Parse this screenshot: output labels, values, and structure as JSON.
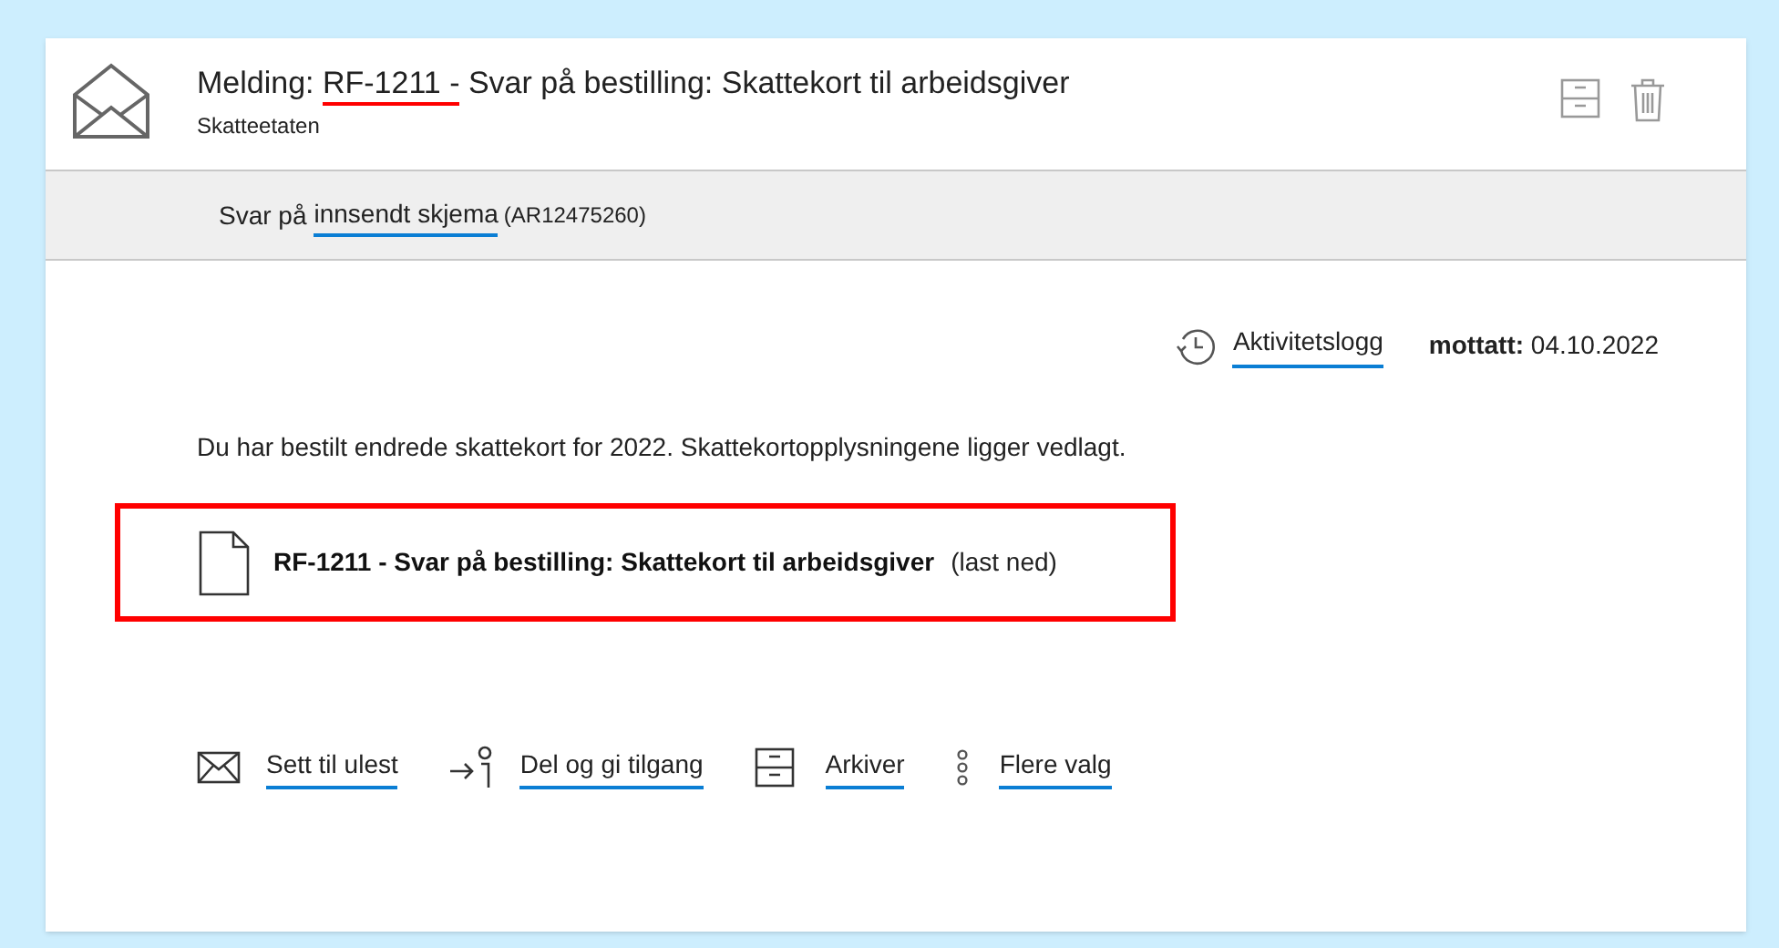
{
  "message": {
    "title_parts": [
      {
        "text": "Melding: ",
        "highlighted": false
      },
      {
        "text": "RF-1211 -",
        "highlighted": true
      },
      {
        "text": " Svar på bestilling: Skattekort til arbeidsgiver",
        "highlighted": false
      }
    ],
    "sender": "Skatteetaten"
  },
  "reply_bar": {
    "prefix": "Svar på",
    "link": "innsendt skjema",
    "reference": "(AR12475260)"
  },
  "activity_log": "Aktivitetslogg",
  "received": {
    "label": "mottatt:",
    "date": "04.10.2022"
  },
  "body": "Du har bestilt endrede skattekort for 2022. Skattekortopplysningene ligger vedlagt.",
  "attachment": {
    "name": "RF-1211 - Svar på bestilling: Skattekort til arbeidsgiver",
    "download": "(last ned)",
    "highlighted": true
  },
  "actions": [
    {
      "kind": "envelope",
      "label": "Sett til ulest"
    },
    {
      "kind": "share",
      "label": "Del og gi tilgang"
    },
    {
      "kind": "archive",
      "label": "Arkiver"
    },
    {
      "kind": "more",
      "label": "Flere valg"
    }
  ]
}
